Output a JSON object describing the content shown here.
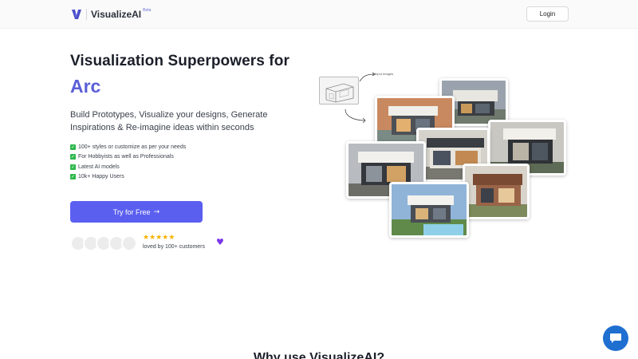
{
  "header": {
    "brand": "VisualizeAI",
    "beta": "Beta",
    "login_label": "Login"
  },
  "hero": {
    "title": "Visualization Superpowers for",
    "accent_word": "Arc",
    "subtitle": "Build Prototypes, Visualize your designs, Generate Inspirations & Re-imagine ideas within seconds",
    "features": [
      "100+ styles or customize as per your needs",
      "For Hobbyists as well as Professionals",
      "Latest AI models",
      "10k+ Happy Users"
    ],
    "cta_label": "Try for Free",
    "stars": "★★★★★",
    "social_proof": "loved by 100+ customers"
  },
  "collage": {
    "input_label": "Input Images"
  },
  "next_section": {
    "heading": "Why use VisualizeAI?"
  },
  "colors": {
    "accent": "#5b5fd7",
    "cta": "#5b5ff0",
    "check": "#2eb84b",
    "star": "#f5b400",
    "heart": "#7a35e8",
    "chat": "#1f6fd1"
  },
  "icons": [
    "logo-v-icon",
    "check-icon",
    "arrow-right-icon",
    "star-icon",
    "heart-icon",
    "chat-icon"
  ]
}
